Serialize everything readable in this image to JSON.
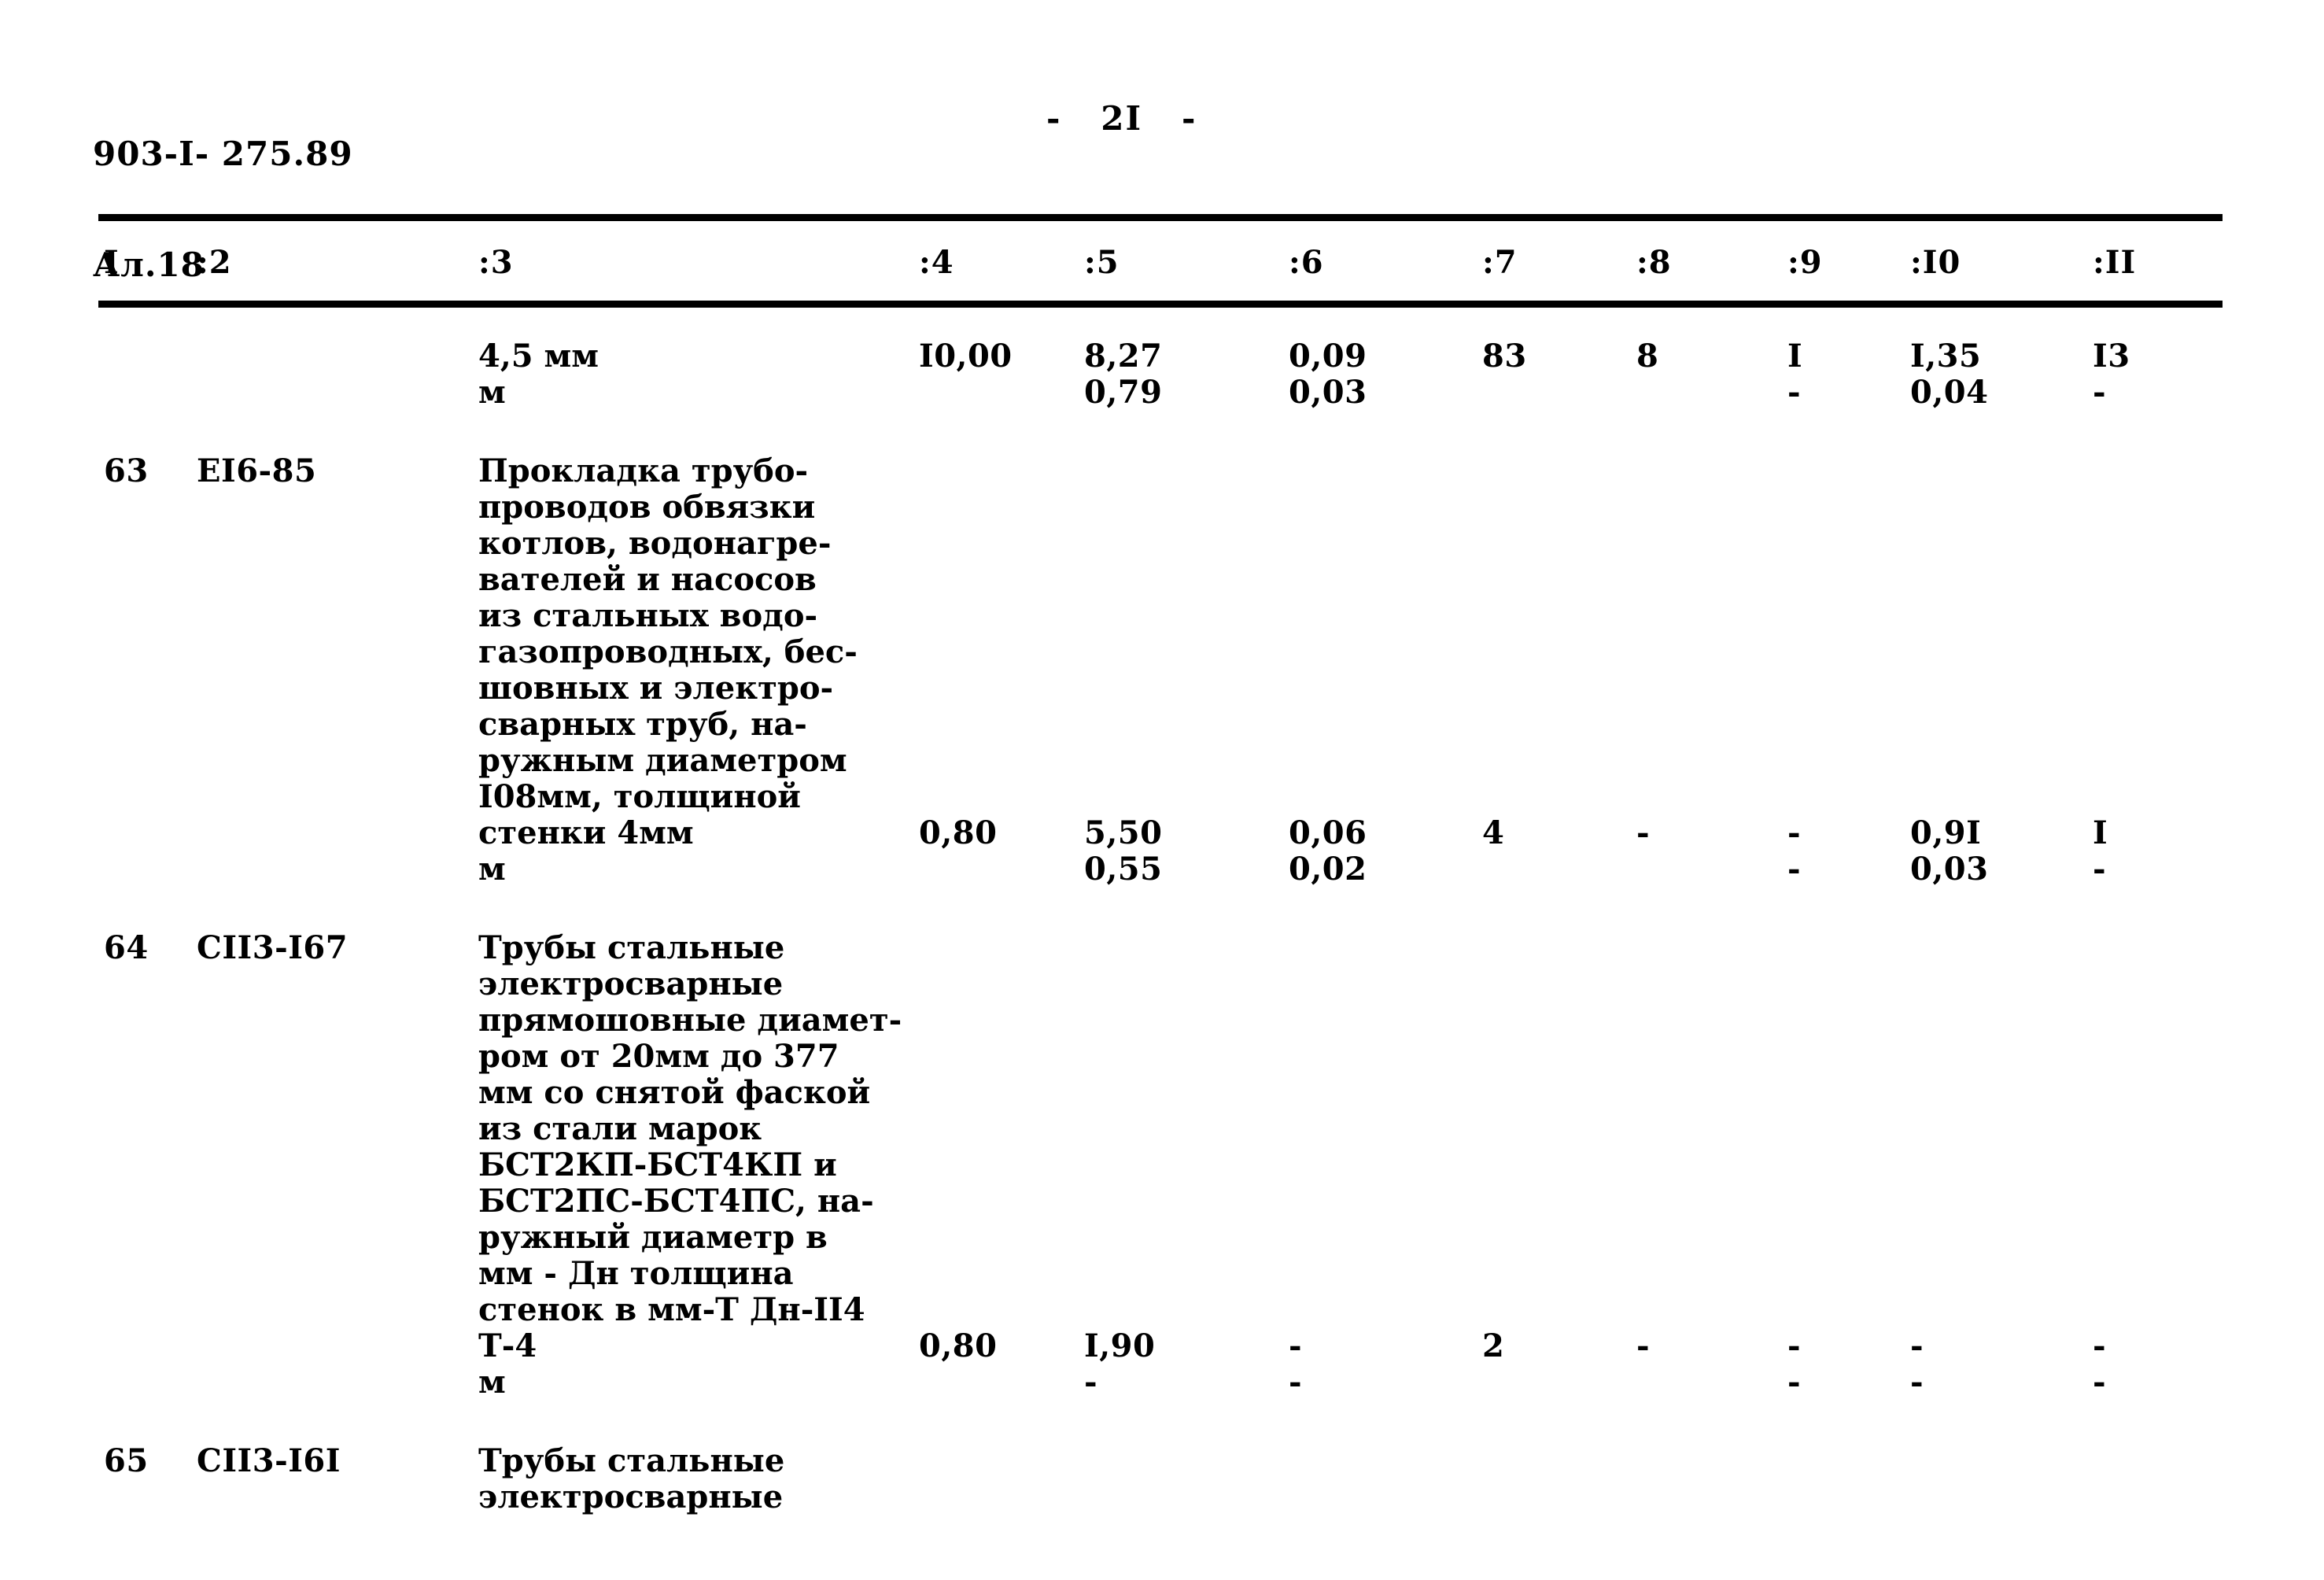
{
  "header": {
    "doc_code_line1": "903-I- 275.89",
    "doc_code_line2": "Ал.18",
    "page_number": "-   2I   -"
  },
  "table": {
    "column_headers": [
      "I",
      ":2",
      ":3",
      ":4",
      ":5",
      ":6",
      ":7",
      ":8",
      ":9",
      ":I0",
      ":II"
    ],
    "rows": [
      {
        "num": "",
        "code": "",
        "desc": [
          "4,5 мм",
          "м"
        ],
        "c4": [
          "I0,00"
        ],
        "c5": [
          "8,27",
          "0,79"
        ],
        "c6": [
          "0,09",
          "0,03"
        ],
        "c7": [
          "83"
        ],
        "c8": [
          "8"
        ],
        "c9": [
          "I",
          "-"
        ],
        "c10": [
          "I,35",
          "0,04"
        ],
        "c11": [
          "I3",
          "-"
        ]
      },
      {
        "num": "63",
        "code": "ЕI6-85",
        "desc": [
          "Прокладка трубо-",
          "проводов обвязки",
          "котлов, водонагре-",
          "вателей и насосов",
          "из стальных водо-",
          "газопроводных, бес-",
          "шовных и электро-",
          "сварных труб, на-",
          "ружным диаметром",
          "I08мм, толщиной",
          "стенки 4мм",
          "м"
        ],
        "c4": [
          "0,80"
        ],
        "c5": [
          "5,50",
          "0,55"
        ],
        "c6": [
          "0,06",
          "0,02"
        ],
        "c7": [
          "4"
        ],
        "c8": [
          "-"
        ],
        "c9": [
          "-",
          "-"
        ],
        "c10": [
          "0,9I",
          "0,03"
        ],
        "c11": [
          "I",
          "-"
        ]
      },
      {
        "num": "64",
        "code": "СII3-I67",
        "desc": [
          "Трубы стальные",
          "электросварные",
          "прямошовные диамет-",
          "ром от 20мм до 377",
          "мм со снятой фаской",
          "из стали марок",
          "БСТ2КП-БСТ4КП и",
          "БСТ2ПС-БСТ4ПС, на-",
          "ружный диаметр в",
          "мм - Дн толщина",
          "стенок в мм-Т Дн-II4",
          "Т-4",
          "м"
        ],
        "c4": [
          "0,80"
        ],
        "c5": [
          "I,90",
          "-"
        ],
        "c6": [
          "-",
          "-"
        ],
        "c7": [
          "2"
        ],
        "c8": [
          "-"
        ],
        "c9": [
          "-",
          "-"
        ],
        "c10": [
          "-",
          "-"
        ],
        "c11": [
          "-",
          "-"
        ]
      },
      {
        "num": "65",
        "code": "СII3-I6I",
        "desc": [
          "Трубы стальные",
          "электросварные"
        ],
        "c4": [],
        "c5": [],
        "c6": [],
        "c7": [],
        "c8": [],
        "c9": [],
        "c10": [],
        "c11": []
      }
    ]
  }
}
